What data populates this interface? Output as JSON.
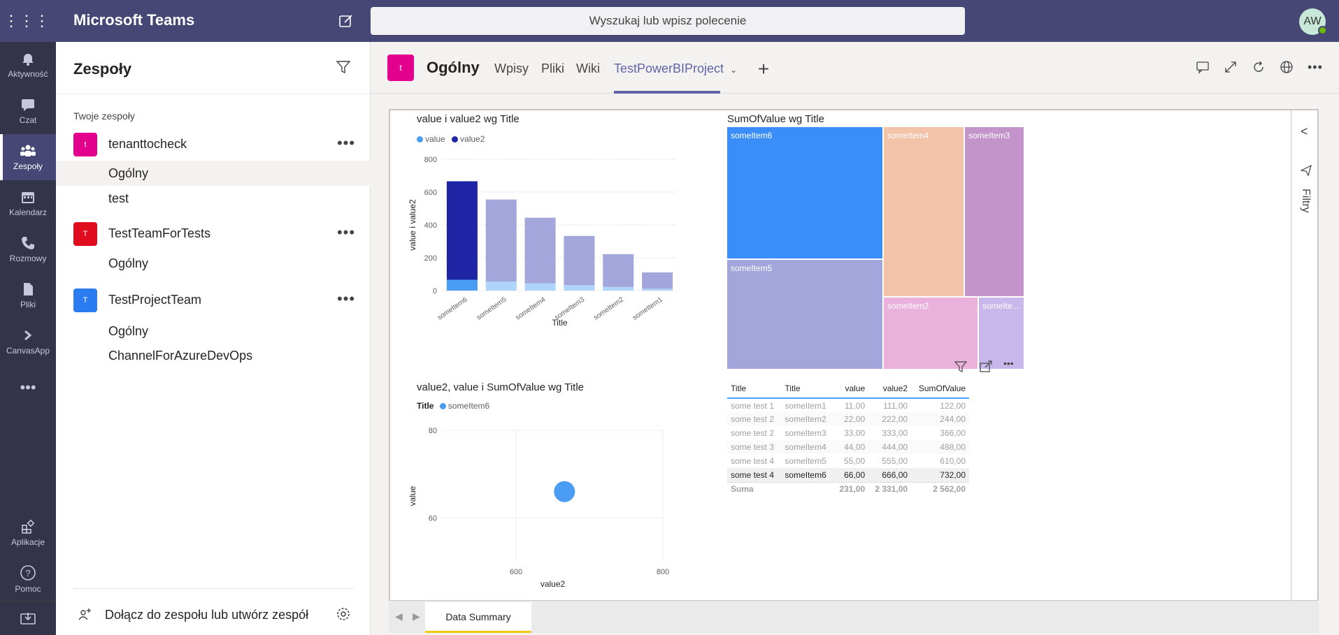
{
  "app": {
    "title": "Microsoft Teams",
    "search_placeholder": "Wyszukaj lub wpisz polecenie",
    "avatar_initials": "AW"
  },
  "rail": [
    {
      "label": "Aktywność",
      "icon": "bell-icon"
    },
    {
      "label": "Czat",
      "icon": "chat-icon"
    },
    {
      "label": "Zespoły",
      "icon": "teams-icon",
      "active": true
    },
    {
      "label": "Kalendarz",
      "icon": "calendar-icon"
    },
    {
      "label": "Rozmowy",
      "icon": "phone-icon"
    },
    {
      "label": "Pliki",
      "icon": "files-icon"
    },
    {
      "label": "CanvasApp",
      "icon": "canvas-icon"
    },
    {
      "label": "Aplikacje",
      "icon": "apps-icon"
    },
    {
      "label": "Pomoc",
      "icon": "help-icon"
    }
  ],
  "teams_panel": {
    "title": "Zespoły",
    "section": "Twoje zespoły",
    "teams": [
      {
        "name": "tenanttocheck",
        "initial": "t",
        "color": "#e3008c",
        "channels": [
          "Ogólny",
          "test"
        ]
      },
      {
        "name": "TestTeamForTests",
        "initial": "T",
        "color": "#e00b1c",
        "channels": [
          "Ogólny"
        ]
      },
      {
        "name": "TestProjectTeam",
        "initial": "T",
        "color": "#2b7bf1",
        "channels": [
          "Ogólny",
          "ChannelForAzureDevOps"
        ]
      }
    ],
    "join_label": "Dołącz do zespołu lub utwórz zespół"
  },
  "channel": {
    "initial": "t",
    "name": "Ogólny",
    "tabs": [
      "Wpisy",
      "Pliki",
      "Wiki",
      "TestPowerBIProject"
    ],
    "active_tab": "TestPowerBIProject"
  },
  "report": {
    "filters_label": "Filtry",
    "page_tab": "Data Summary",
    "bar_title": "value i value2 wg Title",
    "treemap_title": "SumOfValue wg Title",
    "scatter_title": "value2, value i SumOfValue wg Title",
    "scatter_legend_title": "Title"
  },
  "chart_data": [
    {
      "type": "bar",
      "title": "value i value2 wg Title",
      "categories": [
        "someItem6",
        "someItem5",
        "someItem4",
        "someItem3",
        "someItem2",
        "someItem1"
      ],
      "series": [
        {
          "name": "value",
          "values": [
            66,
            55,
            44,
            33,
            22,
            11
          ],
          "color": "#4a9cf5"
        },
        {
          "name": "value2",
          "values": [
            666,
            555,
            444,
            333,
            222,
            111
          ],
          "color": "#1f25a5"
        }
      ],
      "stacked": true,
      "xlabel": "Title",
      "ylabel": "value i value2",
      "ylim": [
        0,
        800
      ],
      "yticks": [
        0,
        200,
        400,
        600,
        800
      ]
    },
    {
      "type": "treemap",
      "title": "SumOfValue wg Title",
      "labels": [
        "someItem6",
        "someItem5",
        "someItem4",
        "someItem3",
        "someItem2",
        "someIte..."
      ],
      "values": [
        732,
        610,
        488,
        366,
        244,
        122
      ],
      "colors": [
        "#3b8ef8",
        "#a3a6da",
        "#f2c3a8",
        "#c394c9",
        "#ebb1dd",
        "#c8b7ea"
      ]
    },
    {
      "type": "scatter",
      "title": "value2, value i SumOfValue wg Title",
      "series": [
        {
          "name": "someItem6",
          "points": [
            {
              "x": 666,
              "y": 66,
              "size": 732
            }
          ],
          "color": "#4a9cf5"
        }
      ],
      "xlabel": "value2",
      "ylabel": "value",
      "xticks": [
        600,
        800
      ],
      "yticks": [
        60,
        80
      ],
      "xlim": [
        500,
        800
      ],
      "ylim": [
        50,
        80
      ]
    },
    {
      "type": "table",
      "columns": [
        "Title",
        "Title",
        "value",
        "value2",
        "SumOfValue"
      ],
      "rows": [
        [
          "some test 1",
          "someItem1",
          "11,00",
          "111,00",
          "122,00"
        ],
        [
          "some test 2",
          "someItem2",
          "22,00",
          "222,00",
          "244,00"
        ],
        [
          "some test 2",
          "someItem3",
          "33,00",
          "333,00",
          "366,00"
        ],
        [
          "some test 3",
          "someItem4",
          "44,00",
          "444,00",
          "488,00"
        ],
        [
          "some test 4",
          "someItem5",
          "55,00",
          "555,00",
          "610,00"
        ],
        [
          "some test 4",
          "someItem6",
          "66,00",
          "666,00",
          "732,00"
        ]
      ],
      "total": [
        "Suma",
        "",
        "231,00",
        "2 331,00",
        "2 562,00"
      ]
    }
  ]
}
